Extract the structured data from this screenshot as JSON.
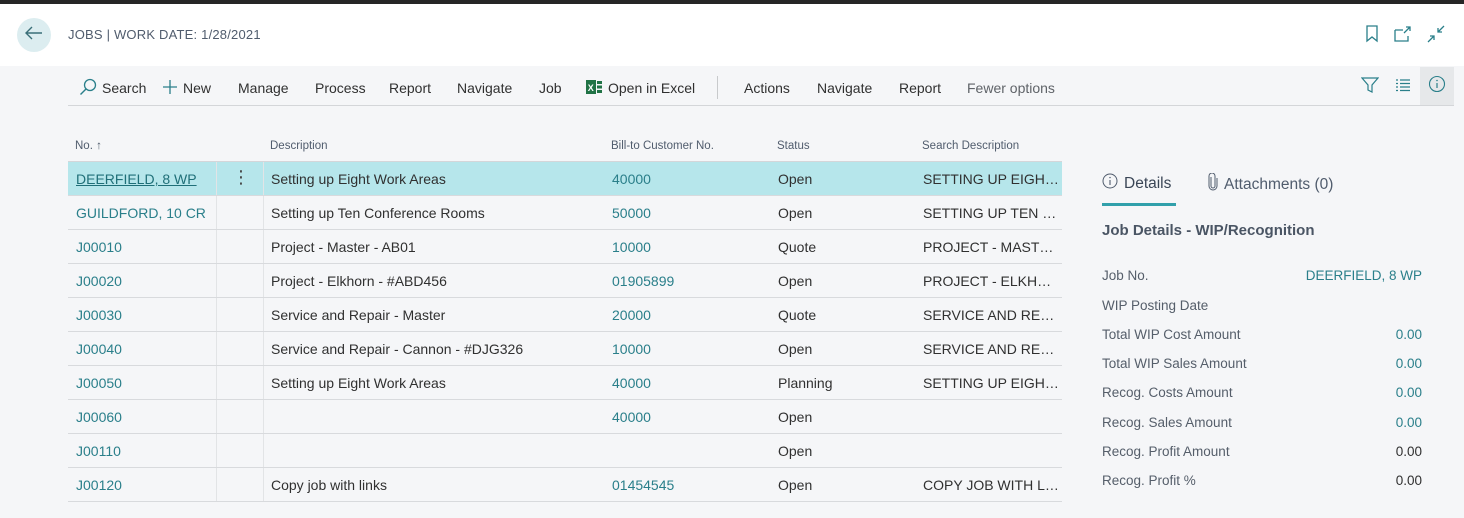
{
  "header": {
    "title": "JOBS | WORK DATE: 1/28/2021",
    "icons": [
      "back-arrow-icon",
      "bookmark-icon",
      "open-new-window-icon",
      "collapse-icon"
    ]
  },
  "actionbar": {
    "items": [
      {
        "label": "Search",
        "icon": "search-icon"
      },
      {
        "label": "New",
        "icon": "plus-icon"
      },
      {
        "label": "Manage"
      },
      {
        "label": "Process"
      },
      {
        "label": "Report"
      },
      {
        "label": "Navigate"
      },
      {
        "label": "Job"
      },
      {
        "label": "Open in Excel",
        "icon": "excel-icon"
      },
      {
        "label": "Actions"
      },
      {
        "label": "Navigate"
      },
      {
        "label": "Report"
      },
      {
        "label": "Fewer options"
      }
    ],
    "right_icons": [
      "filter-icon",
      "list-view-icon",
      "info-icon"
    ]
  },
  "grid": {
    "columns": [
      "No. ↑",
      "Description",
      "Bill-to Customer No.",
      "Status",
      "Search Description"
    ],
    "rows": [
      {
        "no": "DEERFIELD, 8 WP",
        "description": "Setting up Eight Work Areas",
        "bill_to": "40000",
        "status": "Open",
        "search": "SETTING UP EIGHT ...",
        "selected": true
      },
      {
        "no": "GUILDFORD, 10 CR",
        "description": "Setting up Ten Conference Rooms",
        "bill_to": "50000",
        "status": "Open",
        "search": "SETTING UP TEN CO..."
      },
      {
        "no": "J00010",
        "description": "Project - Master - AB01",
        "bill_to": "10000",
        "status": "Quote",
        "search": "PROJECT - MASTER ..."
      },
      {
        "no": "J00020",
        "description": "Project - Elkhorn - #ABD456",
        "bill_to": "01905899",
        "status": "Open",
        "search": "PROJECT - ELKHOR..."
      },
      {
        "no": "J00030",
        "description": "Service and Repair - Master",
        "bill_to": "20000",
        "status": "Quote",
        "search": "SERVICE AND REPAI..."
      },
      {
        "no": "J00040",
        "description": "Service and Repair - Cannon - #DJG326",
        "bill_to": "10000",
        "status": "Open",
        "search": "SERVICE AND REPAI..."
      },
      {
        "no": "J00050",
        "description": "Setting up Eight Work Areas",
        "bill_to": "40000",
        "status": "Planning",
        "search": "SETTING UP EIGHT ..."
      },
      {
        "no": "J00060",
        "description": "",
        "bill_to": "40000",
        "status": "Open",
        "search": ""
      },
      {
        "no": "J00110",
        "description": "",
        "bill_to": "",
        "status": "Open",
        "search": ""
      },
      {
        "no": "J00120",
        "description": "Copy job with links",
        "bill_to": "01454545",
        "status": "Open",
        "search": "COPY JOB WITH LIN..."
      }
    ]
  },
  "factbox": {
    "tabs": [
      {
        "label": "Details",
        "icon": "info-icon",
        "active": true
      },
      {
        "label": "Attachments (0)",
        "icon": "paperclip-icon"
      }
    ],
    "title": "Job Details - WIP/Recognition",
    "fields": [
      {
        "label": "Job No.",
        "value": "DEERFIELD, 8 WP",
        "link": true
      },
      {
        "label": "WIP Posting Date",
        "value": "",
        "link": false
      },
      {
        "label": "Total WIP Cost Amount",
        "value": "0.00",
        "link": true
      },
      {
        "label": "Total WIP Sales Amount",
        "value": "0.00",
        "link": true
      },
      {
        "label": "Recog. Costs Amount",
        "value": "0.00",
        "link": true
      },
      {
        "label": "Recog. Sales Amount",
        "value": "0.00",
        "link": true
      },
      {
        "label": "Recog. Profit Amount",
        "value": "0.00",
        "link": false
      },
      {
        "label": "Recog. Profit %",
        "value": "0.00",
        "link": false
      }
    ]
  },
  "colors": {
    "accent": "#2a7f8a",
    "selected_row": "#b6e6eb",
    "tab_underline": "#31a0ab",
    "excel_green": "#217346"
  }
}
